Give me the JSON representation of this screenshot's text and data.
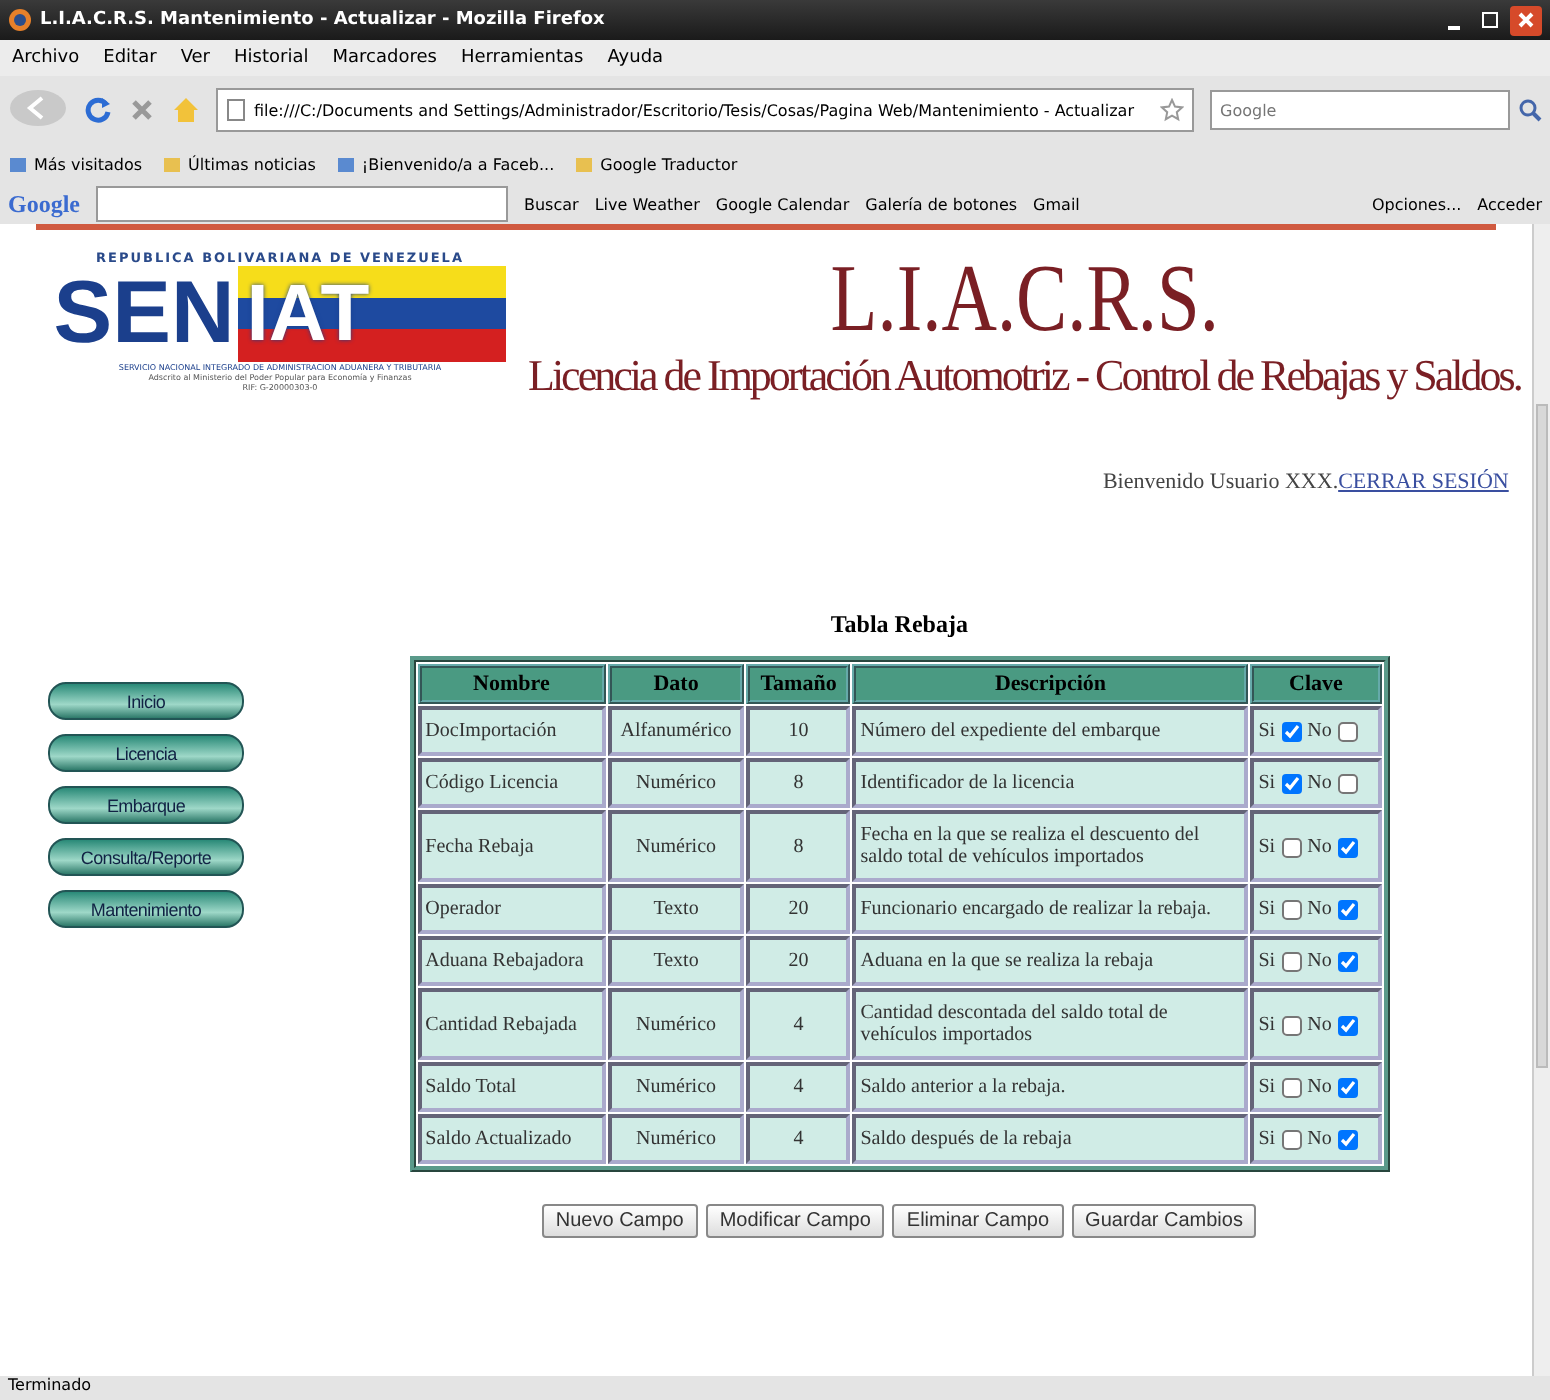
{
  "window": {
    "title": "L.I.A.C.R.S. Mantenimiento - Actualizar - Mozilla Firefox"
  },
  "menu": [
    "Archivo",
    "Editar",
    "Ver",
    "Historial",
    "Marcadores",
    "Herramientas",
    "Ayuda"
  ],
  "address": {
    "url": "file:///C:/Documents and Settings/Administrador/Escritorio/Tesis/Cosas/Pagina Web/Mantenimiento - Actualizar",
    "search_placeholder": "Google"
  },
  "bookmarks": [
    "Más visitados",
    "Últimas noticias",
    "¡Bienvenido/a a Faceb...",
    "Google Traductor"
  ],
  "google_toolbar": {
    "logo": "Google",
    "items": [
      "Buscar",
      "Live Weather",
      "Google Calendar",
      "Galería de botones",
      "Gmail"
    ],
    "right_items": [
      "Opciones...",
      "Acceder"
    ]
  },
  "logo": {
    "top": "REPUBLICA BOLIVARIANA DE VENEZUELA",
    "sen": "SEN",
    "iat": "IAT",
    "line1": "SERVICIO NACIONAL INTEGRADO DE ADMINISTRACION ADUANERA Y TRIBUTARIA",
    "line2": "Adscrito al Ministerio del Poder Popular para Economía y Finanzas",
    "line3": "RIF: G-20000303-0"
  },
  "header": {
    "title": "L.I.A.C.R.S.",
    "subtitle": "Licencia de Importación Automotriz - Control de Rebajas y Saldos."
  },
  "welcome": {
    "text": "Bienvenido Usuario XXX.",
    "link": "CERRAR SESIÓN"
  },
  "sidebar": {
    "items": [
      "Inicio",
      "Licencia",
      "Embarque",
      "Consulta/Reporte",
      "Mantenimiento"
    ]
  },
  "table": {
    "title": "Tabla Rebaja",
    "columns": [
      "Nombre",
      "Dato",
      "Tamaño",
      "Descripción",
      "Clave"
    ],
    "rows": [
      {
        "nombre": "DocImportación",
        "dato": "Alfanumérico",
        "tamano": "10",
        "descripcion": "Número del expediente del embarque",
        "si_label": "Si",
        "si": true,
        "no_label": "No",
        "no": false
      },
      {
        "nombre": "Código Licencia",
        "dato": "Numérico",
        "tamano": "8",
        "descripcion": "Identificador de la licencia",
        "si_label": "Si",
        "si": true,
        "no_label": "No",
        "no": false
      },
      {
        "nombre": "Fecha Rebaja",
        "dato": "Numérico",
        "tamano": "8",
        "descripcion": "Fecha en la que se realiza el descuento del saldo total de vehículos importados",
        "si_label": "Si",
        "si": false,
        "no_label": "No",
        "no": true
      },
      {
        "nombre": "Operador",
        "dato": "Texto",
        "tamano": "20",
        "descripcion": "Funcionario encargado de realizar la rebaja.",
        "si_label": "Si",
        "si": false,
        "no_label": "No",
        "no": true
      },
      {
        "nombre": "Aduana Rebajadora",
        "dato": "Texto",
        "tamano": "20",
        "descripcion": "Aduana en la que se realiza la rebaja",
        "si_label": "Si",
        "si": false,
        "no_label": "No",
        "no": true
      },
      {
        "nombre": "Cantidad Rebajada",
        "dato": "Numérico",
        "tamano": "4",
        "descripcion": "Cantidad descontada del saldo total de vehículos importados",
        "si_label": "Si",
        "si": false,
        "no_label": "No",
        "no": true
      },
      {
        "nombre": "Saldo Total",
        "dato": "Numérico",
        "tamano": "4",
        "descripcion": "Saldo anterior a la rebaja.",
        "si_label": "Si",
        "si": false,
        "no_label": "No",
        "no": true
      },
      {
        "nombre": "Saldo Actualizado",
        "dato": "Numérico",
        "tamano": "4",
        "descripcion": "Saldo después de la rebaja",
        "si_label": "Si",
        "si": false,
        "no_label": "No",
        "no": true
      }
    ]
  },
  "buttons": [
    "Nuevo Campo",
    "Modificar Campo",
    "Eliminar Campo",
    "Guardar Cambios"
  ],
  "status_bar": "Terminado"
}
